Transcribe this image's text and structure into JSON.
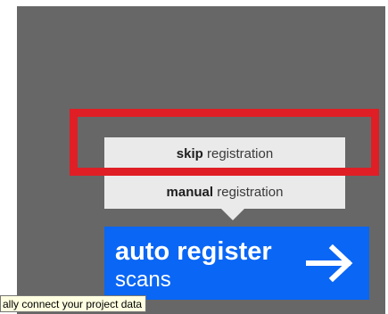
{
  "menu": {
    "skip": {
      "bold": "skip",
      "rest": " registration"
    },
    "manual": {
      "bold": "manual",
      "rest": " registration"
    }
  },
  "auto_button": {
    "line1": "auto register",
    "line2": "scans",
    "icon": "arrow-right-icon"
  },
  "tooltip": {
    "text": "ally connect your project data"
  },
  "colors": {
    "panel_background": "#676767",
    "highlight_border": "#e01e25",
    "menu_background": "#eaeaea",
    "auto_button_background": "#0a66f5",
    "tooltip_background": "#ffffe1"
  }
}
